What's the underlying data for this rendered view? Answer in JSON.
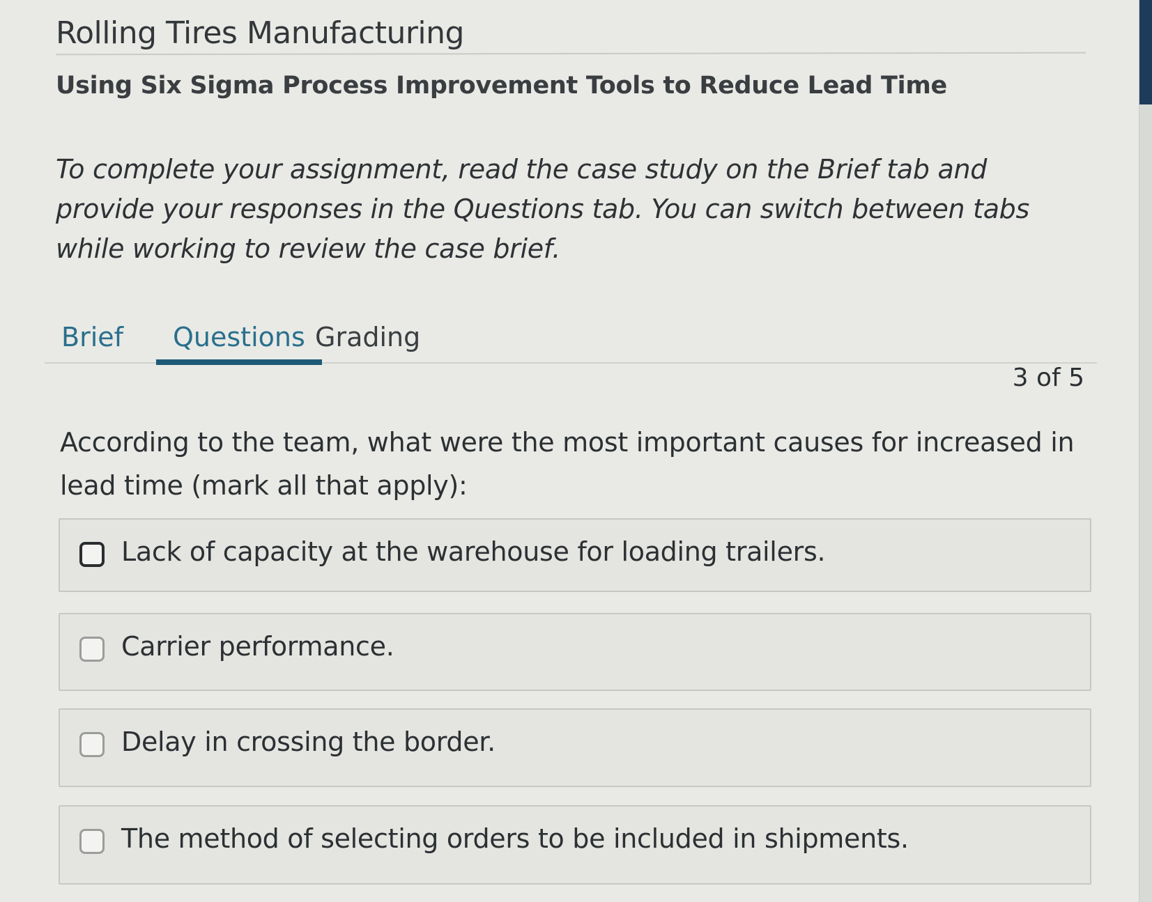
{
  "header": {
    "title": "Rolling Tires Manufacturing",
    "subtitle": "Using Six Sigma Process Improvement Tools to Reduce Lead Time"
  },
  "instructions": "To complete your assignment, read the case study on the Brief tab and provide your responses in the Questions tab. You can switch between tabs while working to review the case brief.",
  "tabs": [
    {
      "label": "Brief",
      "active": false
    },
    {
      "label": "Questions",
      "active": true
    },
    {
      "label": "Grading",
      "active": false
    }
  ],
  "pager": "3 of 5",
  "question": {
    "text": "According to the team, what were the most important causes for increased in lead time (mark all that apply):",
    "options": [
      {
        "label": "Lack of capacity at the warehouse for loading trailers.",
        "checked": false
      },
      {
        "label": "Carrier performance.",
        "checked": false
      },
      {
        "label": "Delay in crossing the border.",
        "checked": false
      },
      {
        "label": "The method of selecting orders to be included in shipments.",
        "checked": false
      }
    ]
  },
  "colors": {
    "tab_accent": "#1f5a78",
    "tab_text": "#2a6f8c",
    "background": "#e9eae6"
  }
}
